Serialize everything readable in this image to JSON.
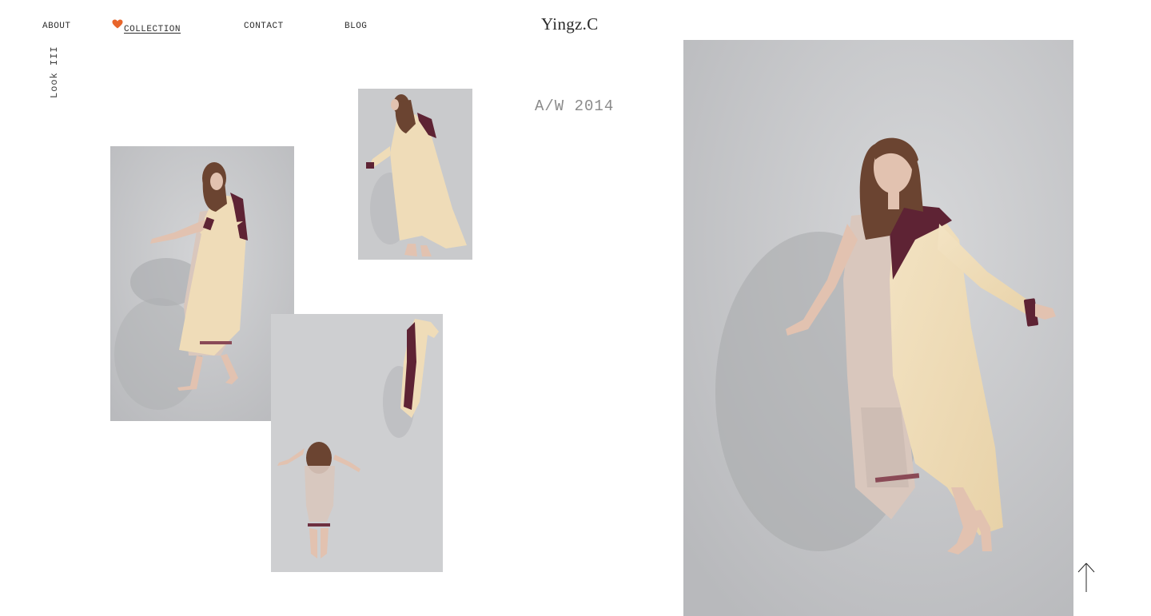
{
  "nav": {
    "about": "ABOUT",
    "collection": "COLLECTION",
    "contact": "CONTACT",
    "blog": "BLOG",
    "active": "collection",
    "active_icon": "heart-icon",
    "heart_color": "#e8652b"
  },
  "brand": {
    "logo": "Yingz.C"
  },
  "look": {
    "label": "Look III"
  },
  "season": {
    "label": "A/W 2014"
  },
  "gallery": {
    "photos": [
      {
        "name": "photo-look-walking"
      },
      {
        "name": "photo-look-side-profile"
      },
      {
        "name": "photo-look-back-view"
      },
      {
        "name": "photo-look-main-featured"
      }
    ],
    "back_to_top_icon": "arrow-up-icon"
  },
  "colors": {
    "background": "#ffffff",
    "photo_backdrop": "#c5c6c8",
    "coat_cream": "#efdcb8",
    "trim_burgundy": "#5e2334",
    "dress_blush": "#d9c7bd",
    "hair_auburn": "#6b4431",
    "skin": "#e2c2b0"
  }
}
